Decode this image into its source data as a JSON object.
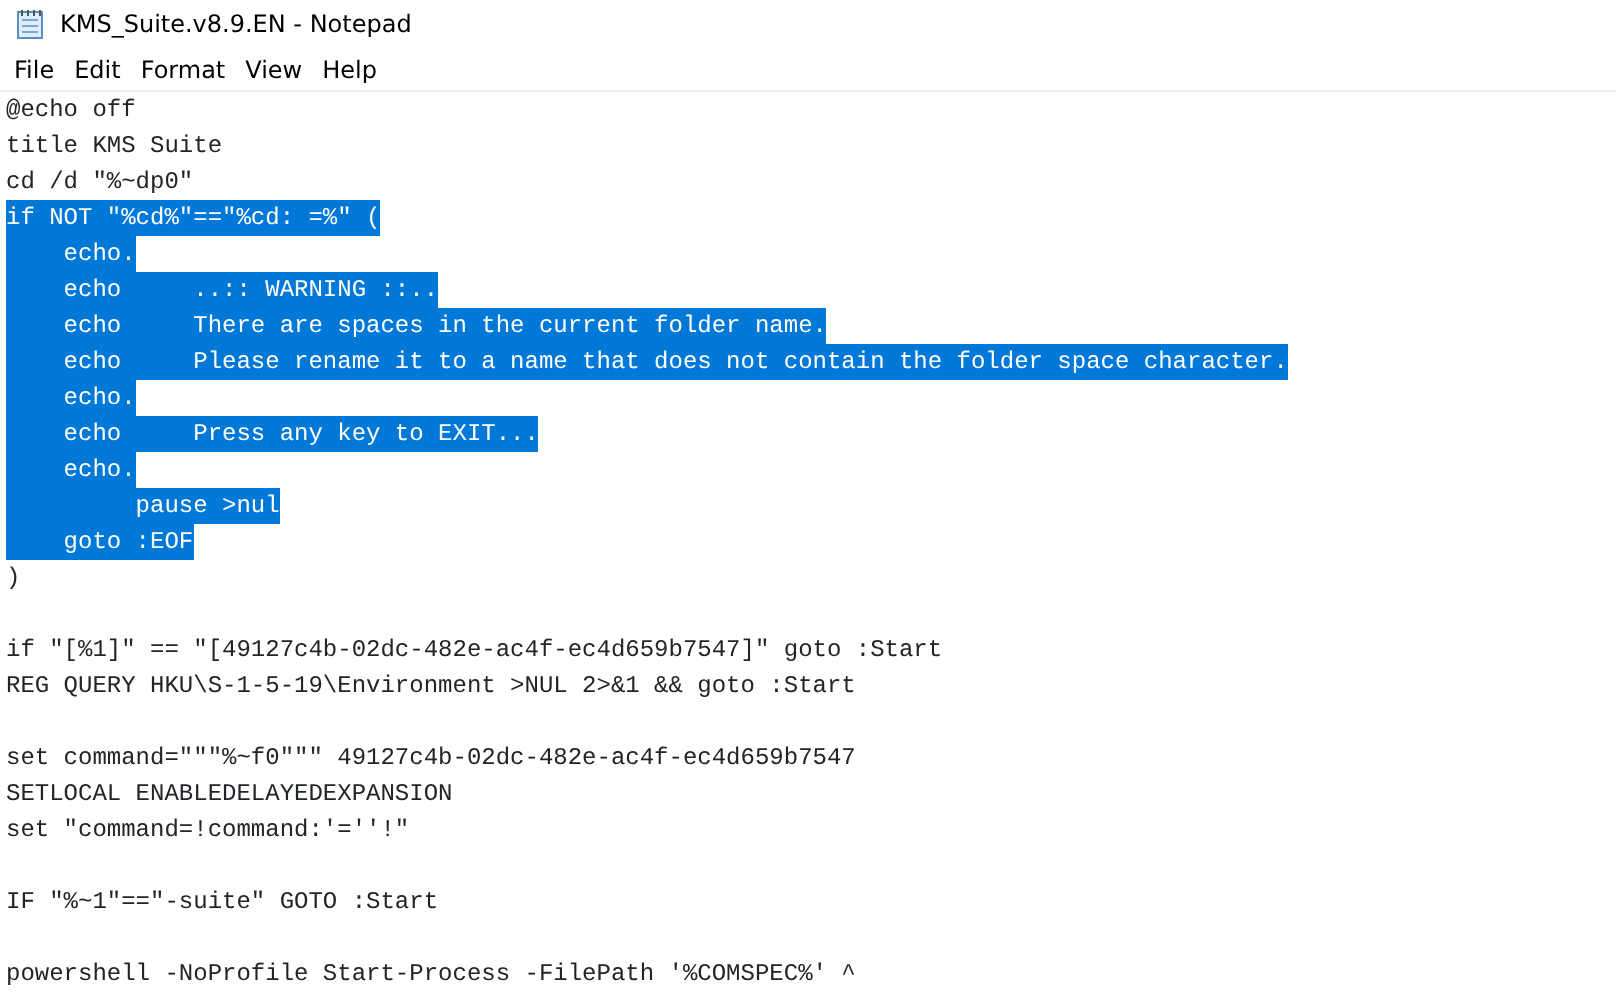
{
  "window": {
    "title": "KMS_Suite.v8.9.EN - Notepad"
  },
  "menu": [
    "File",
    "Edit",
    "Format",
    "View",
    "Help"
  ],
  "lines": [
    {
      "kind": "code",
      "text": "@echo off",
      "selected": false
    },
    {
      "kind": "code",
      "text": "title KMS Suite",
      "selected": false
    },
    {
      "kind": "code",
      "text": "cd /d \"%~dp0\"",
      "selected": false
    },
    {
      "kind": "code",
      "text": "if NOT \"%cd%\"==\"%cd: =%\" (",
      "selected": true
    },
    {
      "kind": "code",
      "text": "    echo.",
      "selected": true
    },
    {
      "kind": "code",
      "text": "    echo     ..:: WARNING ::..",
      "selected": true
    },
    {
      "kind": "code",
      "text": "    echo     There are spaces in the current folder name.",
      "selected": true
    },
    {
      "kind": "code",
      "text": "    echo     Please rename it to a name that does not contain the folder space character.",
      "selected": true
    },
    {
      "kind": "code",
      "text": "    echo.",
      "selected": true
    },
    {
      "kind": "code",
      "text": "    echo     Press any key to EXIT...",
      "selected": true
    },
    {
      "kind": "code",
      "text": "    echo.",
      "selected": true
    },
    {
      "kind": "code",
      "text": "         pause >nul",
      "selected": true
    },
    {
      "kind": "code",
      "text": "    goto :EOF",
      "selected": true
    },
    {
      "kind": "code",
      "text": ")",
      "selected": false
    },
    {
      "kind": "blank"
    },
    {
      "kind": "code",
      "text": "if \"[%1]\" == \"[49127c4b-02dc-482e-ac4f-ec4d659b7547]\" goto :Start",
      "selected": false
    },
    {
      "kind": "code",
      "text": "REG QUERY HKU\\S-1-5-19\\Environment >NUL 2>&1 && goto :Start",
      "selected": false
    },
    {
      "kind": "blank"
    },
    {
      "kind": "code",
      "text": "set command=\"\"\"%~f0\"\"\" 49127c4b-02dc-482e-ac4f-ec4d659b7547",
      "selected": false
    },
    {
      "kind": "code",
      "text": "SETLOCAL ENABLEDELAYEDEXPANSION",
      "selected": false
    },
    {
      "kind": "code",
      "text": "set \"command=!command:'=''!\"",
      "selected": false
    },
    {
      "kind": "blank"
    },
    {
      "kind": "code",
      "text": "IF \"%~1\"==\"-suite\" GOTO :Start",
      "selected": false
    },
    {
      "kind": "blank"
    },
    {
      "kind": "code",
      "text": "powershell -NoProfile Start-Process -FilePath '%COMSPEC%' ^",
      "selected": false
    }
  ]
}
